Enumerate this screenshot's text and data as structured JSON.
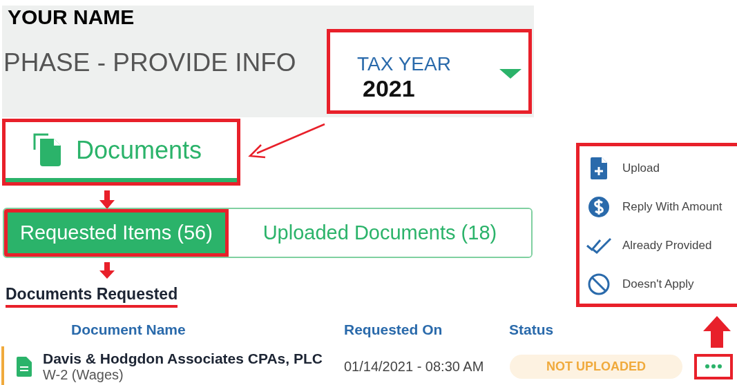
{
  "header": {
    "name": "YOUR NAME",
    "phase": "PHASE - PROVIDE INFO"
  },
  "tax_year": {
    "label": "TAX YEAR",
    "value": "2021"
  },
  "section_tab": {
    "label": "Documents",
    "selected": true
  },
  "tabs": [
    {
      "label": "Requested Items (56)",
      "selected": true
    },
    {
      "label": "Uploaded Documents (18)",
      "selected": false
    }
  ],
  "section_title": "Documents Requested",
  "table": {
    "columns": [
      "Document Name",
      "Requested On",
      "Status"
    ],
    "rows": [
      {
        "name": "Davis & Hodgdon Associates CPAs, PLC",
        "type": "W-2 (Wages)",
        "requested_on": "01/14/2021 - 08:30 AM",
        "status": "NOT UPLOADED"
      }
    ]
  },
  "menu": [
    {
      "kind": "upload",
      "label": "Upload"
    },
    {
      "kind": "amount",
      "label": "Reply With Amount"
    },
    {
      "kind": "provided",
      "label": "Already Provided"
    },
    {
      "kind": "na",
      "label": "Doesn't Apply"
    }
  ]
}
